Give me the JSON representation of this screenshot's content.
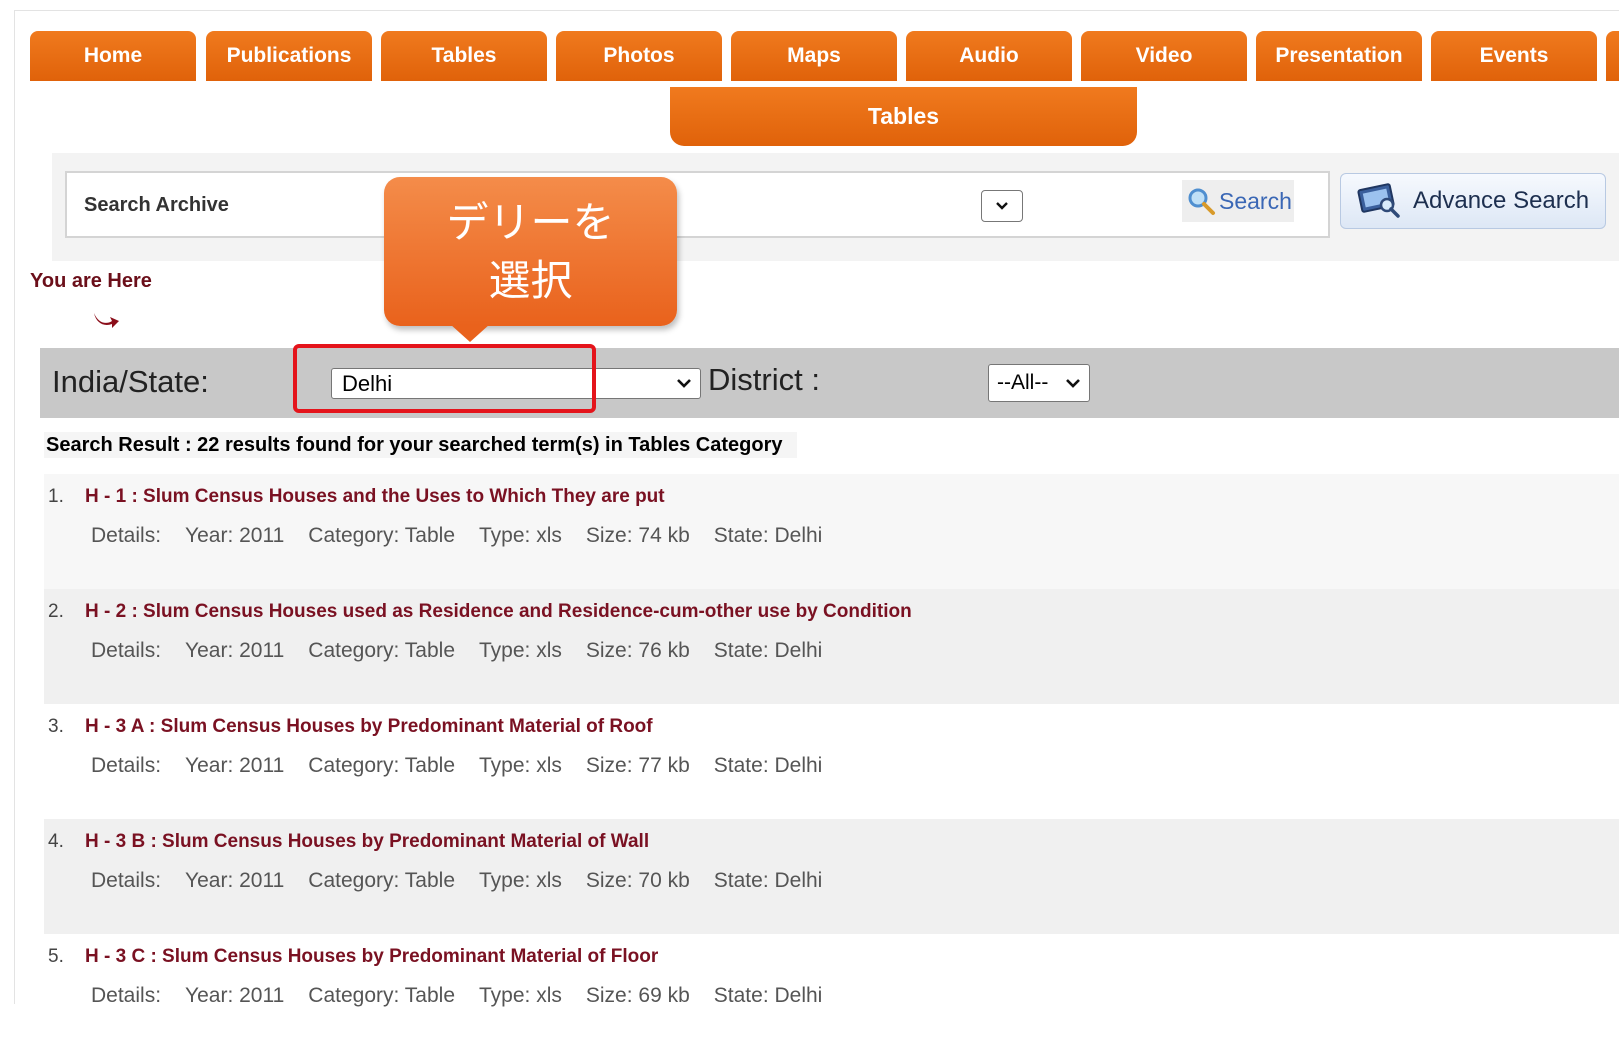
{
  "nav": {
    "tabs": [
      "Home",
      "Publications",
      "Tables",
      "Photos",
      "Maps",
      "Audio",
      "Video",
      "Presentation",
      "Events",
      ""
    ]
  },
  "sub_tab": {
    "label": "Tables"
  },
  "search": {
    "label": "Search Archive",
    "button": "Search",
    "advance_button": "Advance Search"
  },
  "breadcrumb": {
    "label": "You are Here"
  },
  "callout": {
    "text": "デリーを\n選択"
  },
  "filter": {
    "state_label": "India/State:",
    "state_value": "Delhi",
    "district_label": "District :",
    "district_value": "--All--"
  },
  "results": {
    "summary": "Search Result : 22 results found for your searched term(s) in Tables Category",
    "items": [
      {
        "num": "1.",
        "title": "H - 1 : Slum Census Houses and the Uses to Which They are put",
        "details": "Details:",
        "year": "Year: 2011",
        "category": "Category: Table",
        "type": "Type: xls",
        "size": "Size: 74 kb",
        "state": "State: Delhi"
      },
      {
        "num": "2.",
        "title": "H - 2 : Slum Census Houses used as Residence and Residence-cum-other use by Condition",
        "details": "Details:",
        "year": "Year: 2011",
        "category": "Category: Table",
        "type": "Type: xls",
        "size": "Size: 76 kb",
        "state": "State: Delhi"
      },
      {
        "num": "3.",
        "title": "H - 3 A : Slum Census Houses by Predominant Material of Roof",
        "details": "Details:",
        "year": "Year: 2011",
        "category": "Category: Table",
        "type": "Type: xls",
        "size": "Size: 77 kb",
        "state": "State: Delhi"
      },
      {
        "num": "4.",
        "title": "H - 3 B : Slum Census Houses by Predominant Material of Wall",
        "details": "Details:",
        "year": "Year: 2011",
        "category": "Category: Table",
        "type": "Type: xls",
        "size": "Size: 70 kb",
        "state": "State: Delhi"
      },
      {
        "num": "5.",
        "title": "H - 3 C : Slum Census Houses by Predominant Material of Floor",
        "details": "Details:",
        "year": "Year: 2011",
        "category": "Category: Table",
        "type": "Type: xls",
        "size": "Size: 69 kb",
        "state": "State: Delhi"
      }
    ]
  },
  "colors": {
    "accent": "#e96a12",
    "highlight": "#e4141b",
    "link": "#7a1122"
  }
}
